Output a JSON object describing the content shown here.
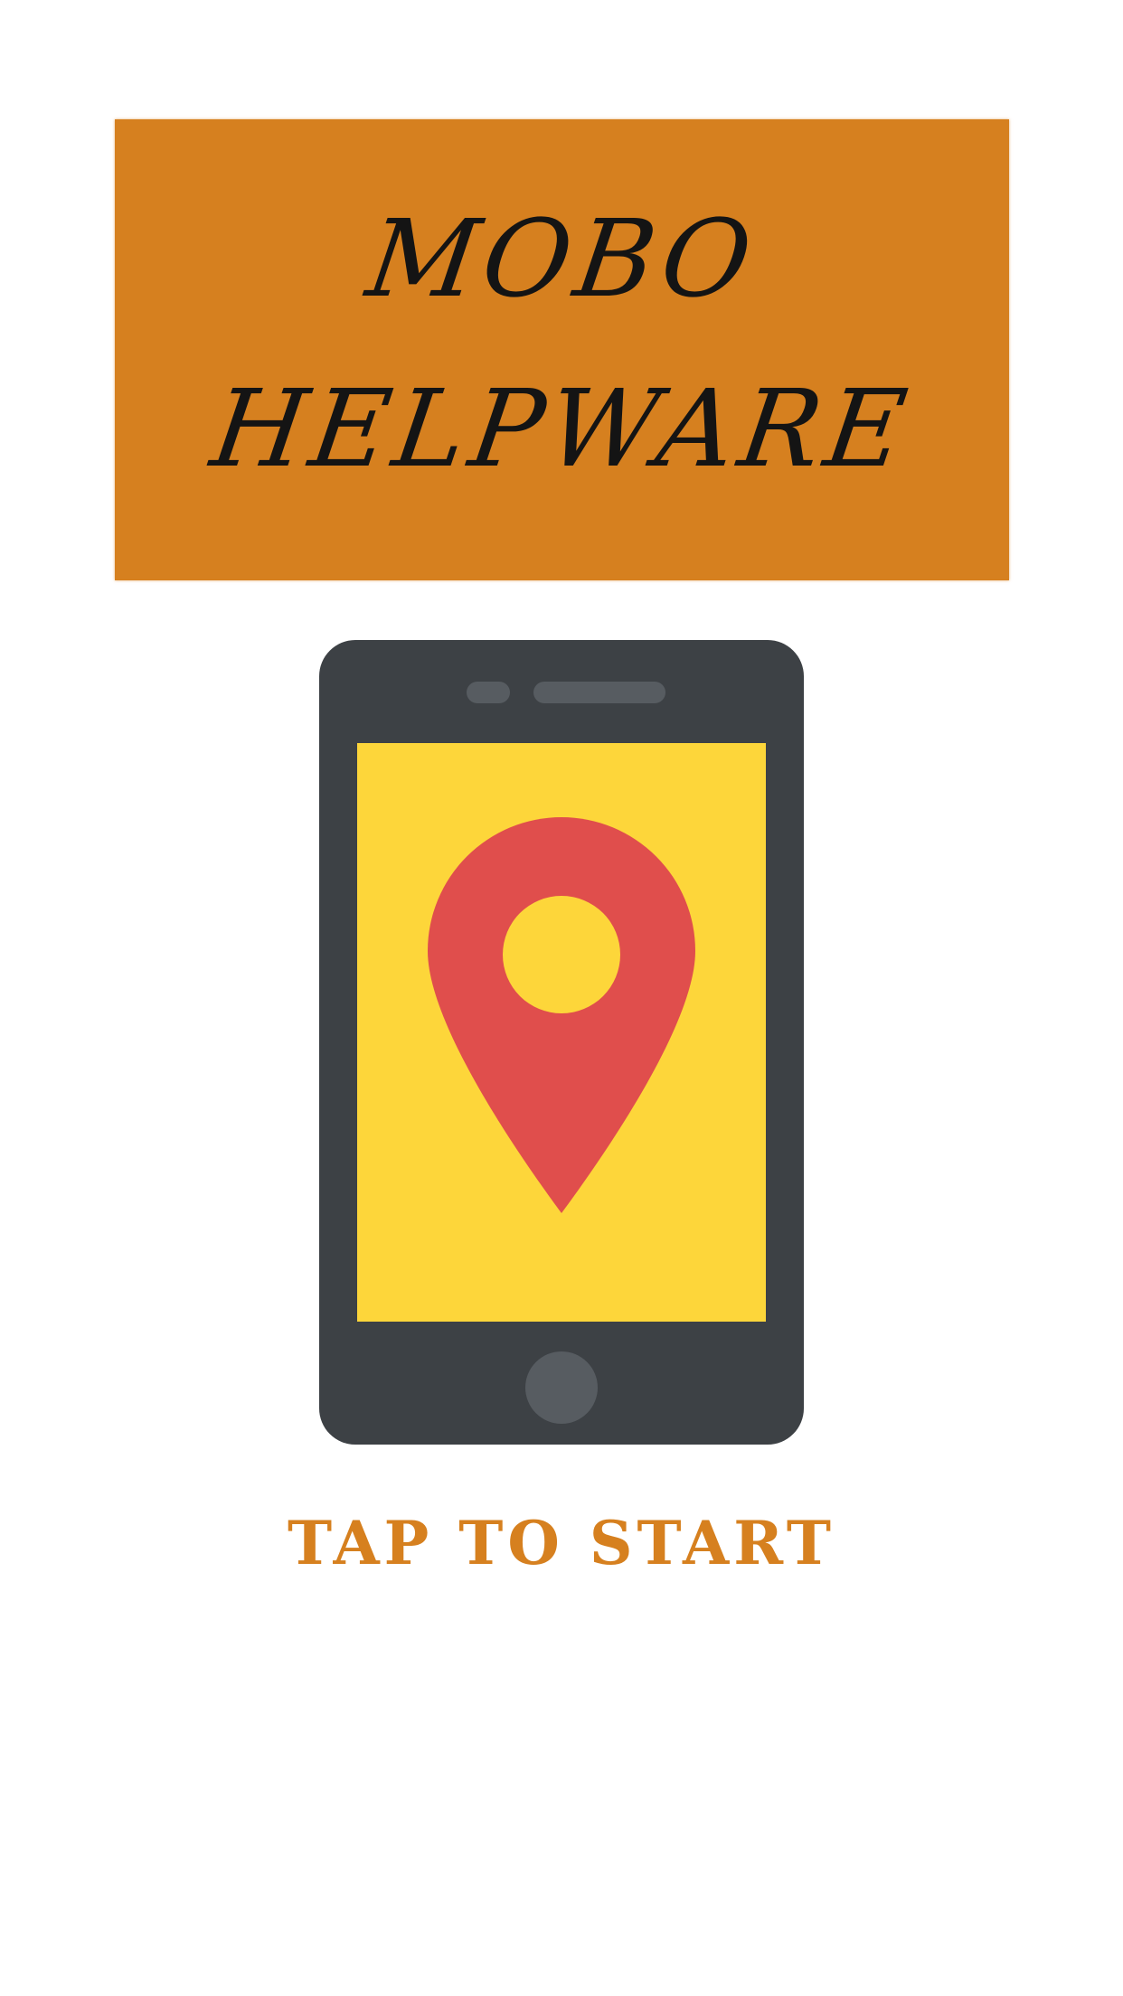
{
  "banner": {
    "title_line_1": "MOBO",
    "title_line_2": "HELPWARE",
    "background_color": "#d6801f"
  },
  "illustration": {
    "icon": "smartphone-location-pin-icon",
    "phone_color": "#3d4145",
    "screen_color": "#fdd63a",
    "pin_color": "#e04e4c"
  },
  "start": {
    "label": "TAP TO START",
    "color": "#d6801f"
  }
}
